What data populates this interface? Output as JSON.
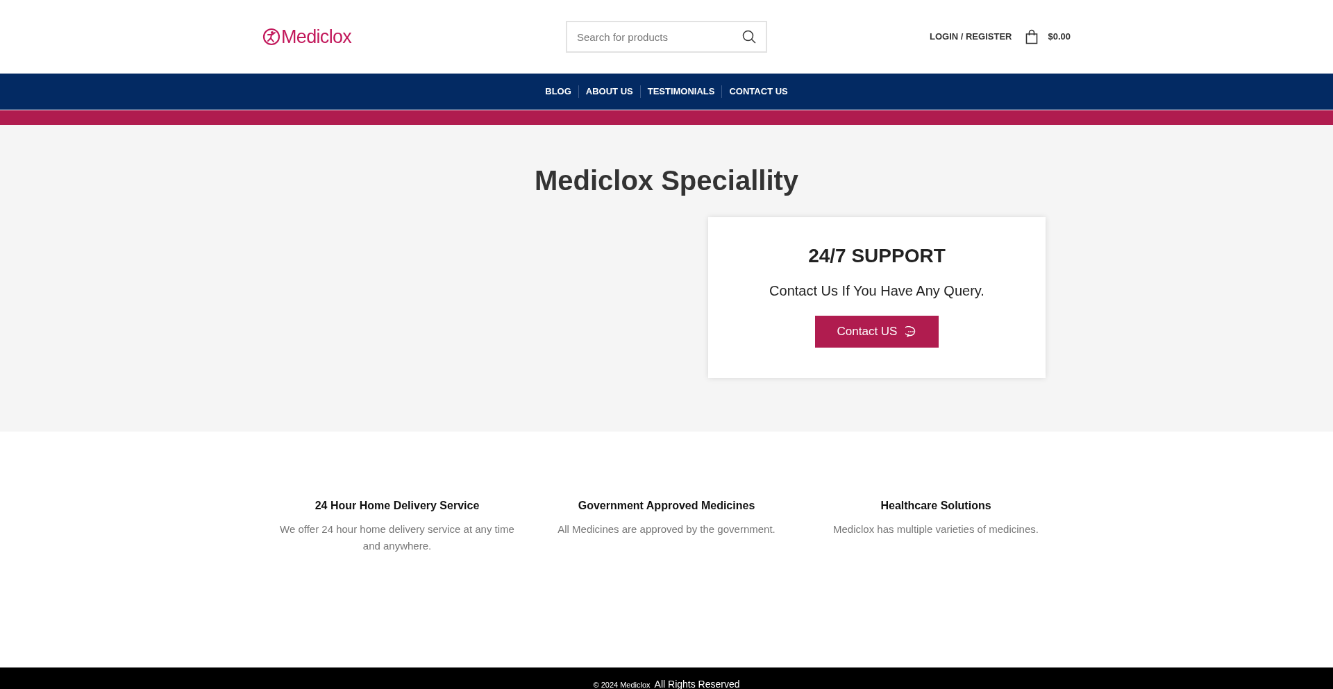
{
  "header": {
    "logo": "Mediclox",
    "search": {
      "placeholder": "Search for products"
    },
    "account_link": "LOGIN / REGISTER",
    "cart_total": "$0.00"
  },
  "nav": [
    "BLOG",
    "ABOUT US",
    "TESTIMONIALS",
    "CONTACT US"
  ],
  "hero": {
    "title": "Mediclox Speciallity",
    "support_card": {
      "title": "24/7 SUPPORT",
      "text": "Contact Us If You Have Any Query.",
      "button": "Contact US"
    }
  },
  "features": [
    {
      "title": "24 Hour Home Delivery Service",
      "text": "We offer 24 hour home delivery service at any time and anywhere."
    },
    {
      "title": "Government Approved Medicines",
      "text": "All Medicines are approved by the government."
    },
    {
      "title": "Healthcare Solutions",
      "text": "Mediclox has multiple varieties of medicines."
    }
  ],
  "footer": {
    "copyright": "© 2024 Mediclox",
    "rights": "All Rights Reserved"
  }
}
